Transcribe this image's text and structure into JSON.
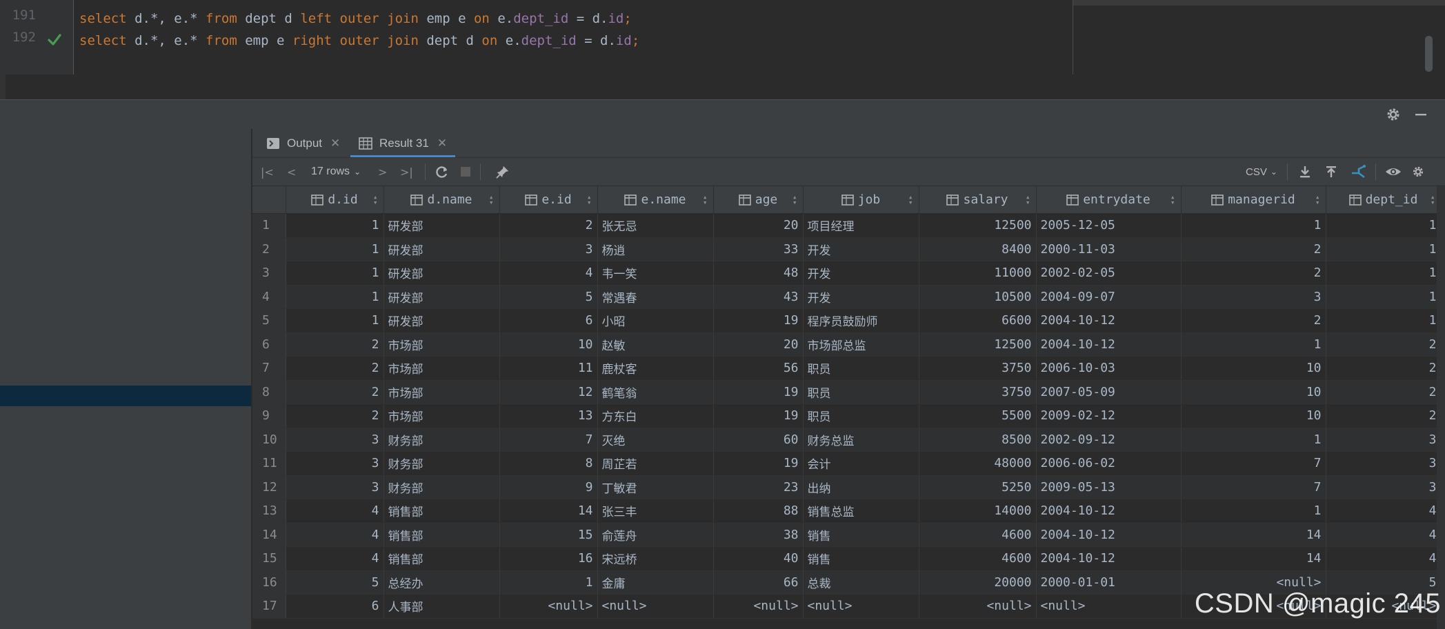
{
  "editor": {
    "lines": [
      {
        "num": "191",
        "tokens": [
          {
            "t": "select",
            "c": "kw"
          },
          {
            "t": " d.*, e.* ",
            "c": ""
          },
          {
            "t": "from",
            "c": "kw"
          },
          {
            "t": " dept d ",
            "c": ""
          },
          {
            "t": "left outer join",
            "c": "kw"
          },
          {
            "t": " emp e ",
            "c": ""
          },
          {
            "t": "on",
            "c": "kw"
          },
          {
            "t": " e.",
            "c": ""
          },
          {
            "t": "dept_id",
            "c": "fld"
          },
          {
            "t": " = d.",
            "c": ""
          },
          {
            "t": "id",
            "c": "fld"
          },
          {
            "t": ";",
            "c": "kw"
          }
        ]
      },
      {
        "num": "192",
        "tokens": [
          {
            "t": "select",
            "c": "kw"
          },
          {
            "t": " d.*, e.* ",
            "c": ""
          },
          {
            "t": "from",
            "c": "kw"
          },
          {
            "t": " emp e ",
            "c": ""
          },
          {
            "t": "right outer join",
            "c": "kw"
          },
          {
            "t": " dept d ",
            "c": ""
          },
          {
            "t": "on",
            "c": "kw"
          },
          {
            "t": " e.",
            "c": ""
          },
          {
            "t": "dept_id",
            "c": "fld"
          },
          {
            "t": " = d.",
            "c": ""
          },
          {
            "t": "id",
            "c": "fld"
          },
          {
            "t": ";",
            "c": "kw"
          }
        ]
      }
    ],
    "line192_status_icon": "check-icon"
  },
  "tabs": [
    {
      "label": "Output",
      "icon": "console-icon",
      "active": false
    },
    {
      "label": "Result 31",
      "icon": "table-icon",
      "active": true
    }
  ],
  "toolbar": {
    "rows_label": "17 rows",
    "export_format": "CSV",
    "icons": [
      "first-page-icon",
      "prev-page-icon",
      "next-page-icon",
      "last-page-icon",
      "refresh-icon",
      "stop-icon",
      "pin-icon",
      "download-icon",
      "upload-icon",
      "compare-icon",
      "eye-icon",
      "settings-icon"
    ]
  },
  "table": {
    "columns": [
      "d.id",
      "d.name",
      "e.id",
      "e.name",
      "age",
      "job",
      "salary",
      "entrydate",
      "managerid",
      "dept_id"
    ],
    "rows": [
      [
        "1",
        "研发部",
        "2",
        "张无忌",
        "20",
        "项目经理",
        "12500",
        "2005-12-05",
        "1",
        "1"
      ],
      [
        "1",
        "研发部",
        "3",
        "杨逍",
        "33",
        "开发",
        "8400",
        "2000-11-03",
        "2",
        "1"
      ],
      [
        "1",
        "研发部",
        "4",
        "韦一笑",
        "48",
        "开发",
        "11000",
        "2002-02-05",
        "2",
        "1"
      ],
      [
        "1",
        "研发部",
        "5",
        "常遇春",
        "43",
        "开发",
        "10500",
        "2004-09-07",
        "3",
        "1"
      ],
      [
        "1",
        "研发部",
        "6",
        "小昭",
        "19",
        "程序员鼓励师",
        "6600",
        "2004-10-12",
        "2",
        "1"
      ],
      [
        "2",
        "市场部",
        "10",
        "赵敏",
        "20",
        "市场部总监",
        "12500",
        "2004-10-12",
        "1",
        "2"
      ],
      [
        "2",
        "市场部",
        "11",
        "鹿杖客",
        "56",
        "职员",
        "3750",
        "2006-10-03",
        "10",
        "2"
      ],
      [
        "2",
        "市场部",
        "12",
        "鹤笔翁",
        "19",
        "职员",
        "3750",
        "2007-05-09",
        "10",
        "2"
      ],
      [
        "2",
        "市场部",
        "13",
        "方东白",
        "19",
        "职员",
        "5500",
        "2009-02-12",
        "10",
        "2"
      ],
      [
        "3",
        "财务部",
        "7",
        "灭绝",
        "60",
        "财务总监",
        "8500",
        "2002-09-12",
        "1",
        "3"
      ],
      [
        "3",
        "财务部",
        "8",
        "周芷若",
        "19",
        "会计",
        "48000",
        "2006-06-02",
        "7",
        "3"
      ],
      [
        "3",
        "财务部",
        "9",
        "丁敏君",
        "23",
        "出纳",
        "5250",
        "2009-05-13",
        "7",
        "3"
      ],
      [
        "4",
        "销售部",
        "14",
        "张三丰",
        "88",
        "销售总监",
        "14000",
        "2004-10-12",
        "1",
        "4"
      ],
      [
        "4",
        "销售部",
        "15",
        "俞莲舟",
        "38",
        "销售",
        "4600",
        "2004-10-12",
        "14",
        "4"
      ],
      [
        "4",
        "销售部",
        "16",
        "宋远桥",
        "40",
        "销售",
        "4600",
        "2004-10-12",
        "14",
        "4"
      ],
      [
        "5",
        "总经办",
        "1",
        "金庸",
        "66",
        "总裁",
        "20000",
        "2000-01-01",
        "<null>",
        "5"
      ],
      [
        "6",
        "人事部",
        "<null>",
        "<null>",
        "<null>",
        "<null>",
        "<null>",
        "<null>",
        "<null>",
        "<null>"
      ]
    ]
  },
  "watermark": "CSDN @magic 245"
}
